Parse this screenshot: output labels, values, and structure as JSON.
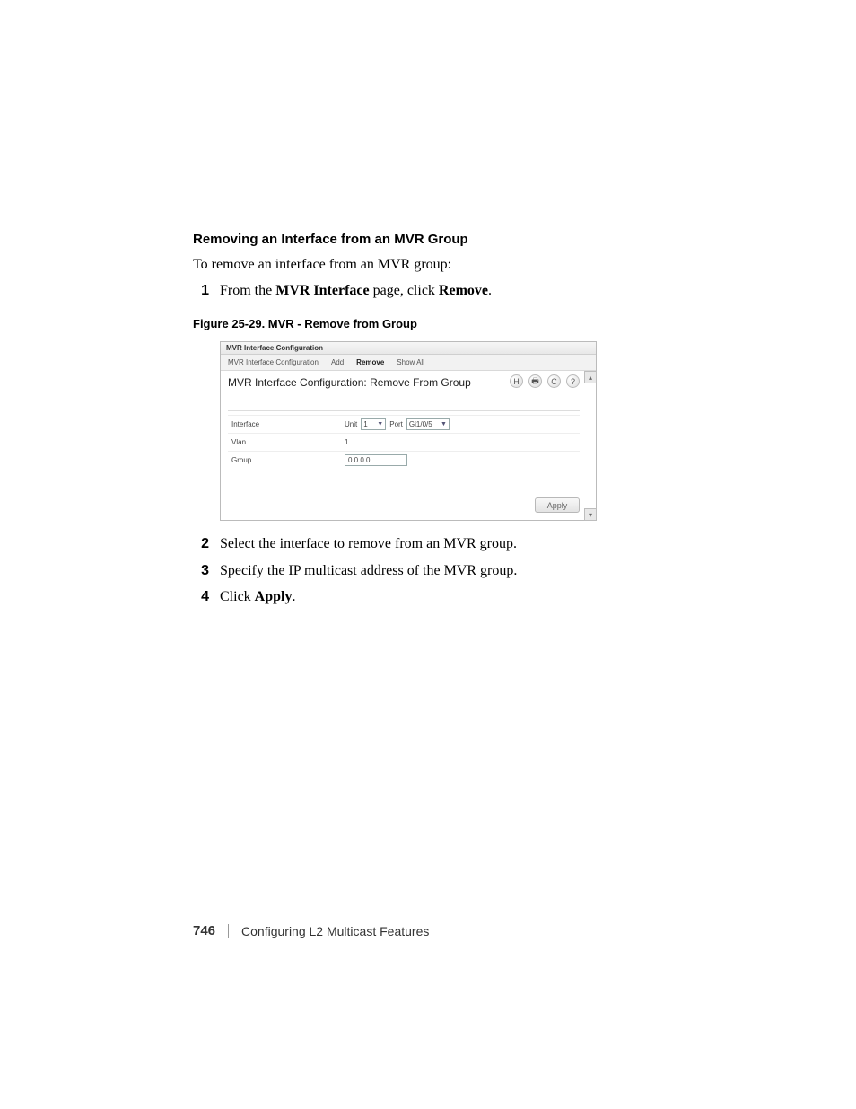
{
  "heading": "Removing an Interface from an MVR Group",
  "intro": "To remove an interface from an MVR group:",
  "step1": {
    "num": "1",
    "pre": "From the ",
    "bold1": "MVR Interface",
    "mid": " page, click ",
    "bold2": "Remove",
    "post": "."
  },
  "figcaption": "Figure 25-29.    MVR - Remove from Group",
  "shot": {
    "titlebar": "MVR Interface Configuration",
    "tabs": {
      "t1": "MVR Interface Configuration",
      "t2": "Add",
      "t3": "Remove",
      "t4": "Show All"
    },
    "pageTitle": "MVR Interface Configuration: Remove From Group",
    "icons": {
      "save": "H",
      "print": "🖶",
      "refresh": "C",
      "help": "?"
    },
    "rows": {
      "interface": {
        "label": "Interface",
        "unitLabel": "Unit",
        "unitValue": "1",
        "portLabel": "Port",
        "portValue": "Gi1/0/5"
      },
      "vlan": {
        "label": "Vlan",
        "value": "1"
      },
      "group": {
        "label": "Group",
        "value": "0.0.0.0"
      }
    },
    "apply": "Apply",
    "scrollUp": "▴",
    "scrollDown": "▾"
  },
  "step2": {
    "num": "2",
    "text": "Select the interface to remove from an MVR group."
  },
  "step3": {
    "num": "3",
    "text": "Specify the IP multicast address of the MVR group."
  },
  "step4": {
    "num": "4",
    "pre": "Click ",
    "bold": "Apply",
    "post": "."
  },
  "footer": {
    "page": "746",
    "chapter": "Configuring L2 Multicast Features"
  }
}
